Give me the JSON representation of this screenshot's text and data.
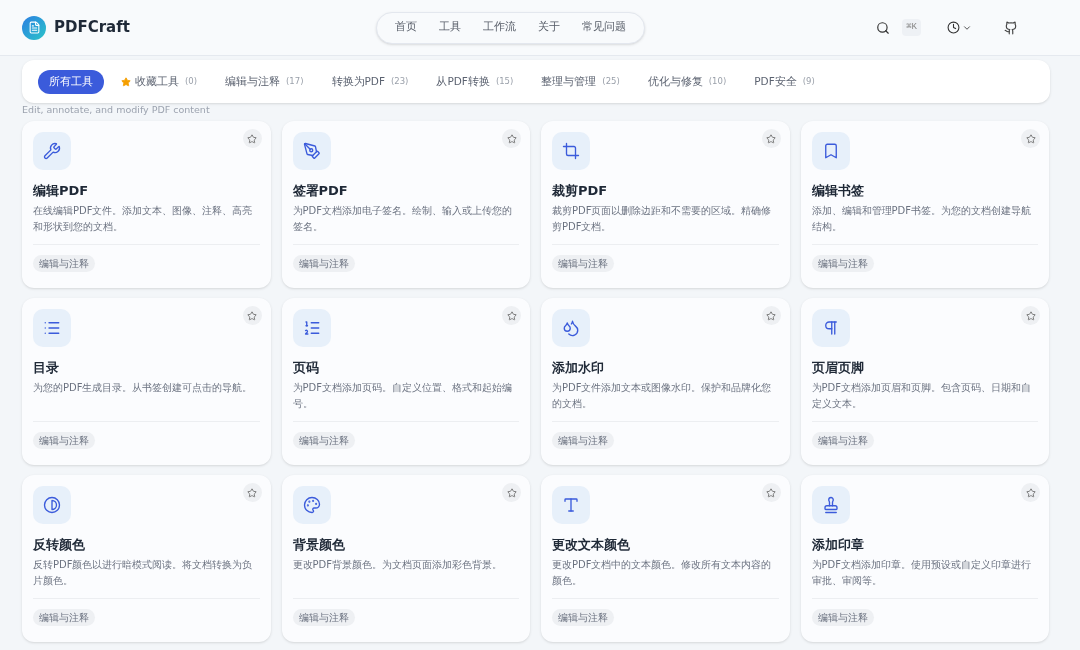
{
  "brand": {
    "name": "PDFCraft"
  },
  "nav": [
    {
      "label": "首页"
    },
    {
      "label": "工具"
    },
    {
      "label": "工作流"
    },
    {
      "label": "关于"
    },
    {
      "label": "常见问题"
    }
  ],
  "shortcut": "⌘K",
  "filters": [
    {
      "label": "所有工具",
      "kind": "plain",
      "selected": true
    },
    {
      "label": "收藏工具",
      "count": "(0)",
      "kind": "favorites",
      "selected": false
    },
    {
      "label": "编辑与注释",
      "count": "(17)",
      "kind": "plain",
      "selected": false
    },
    {
      "label": "转换为PDF",
      "count": "(23)",
      "kind": "plain",
      "selected": false
    },
    {
      "label": "从PDF转换",
      "count": "(15)",
      "kind": "plain",
      "selected": false
    },
    {
      "label": "整理与管理",
      "count": "(25)",
      "kind": "plain",
      "selected": false
    },
    {
      "label": "优化与修复",
      "count": "(10)",
      "kind": "plain",
      "selected": false
    },
    {
      "label": "PDF安全",
      "count": "(9)",
      "kind": "plain",
      "selected": false
    }
  ],
  "subtitle": "Edit, annotate, and modify PDF content",
  "tools": [
    {
      "title": "编辑PDF",
      "description": "在线编辑PDF文件。添加文本、图像、注释、高亮和形状到您的文档。",
      "tag": "编辑与注释"
    },
    {
      "title": "签署PDF",
      "description": "为PDF文档添加电子签名。绘制、输入或上传您的签名。",
      "tag": "编辑与注释"
    },
    {
      "title": "裁剪PDF",
      "description": "裁剪PDF页面以删除边距和不需要的区域。精确修剪PDF文档。",
      "tag": "编辑与注释"
    },
    {
      "title": "编辑书签",
      "description": "添加、编辑和管理PDF书签。为您的文档创建导航结构。",
      "tag": "编辑与注释"
    },
    {
      "title": "目录",
      "description": "为您的PDF生成目录。从书签创建可点击的导航。",
      "tag": "编辑与注释"
    },
    {
      "title": "页码",
      "description": "为PDF文档添加页码。自定义位置、格式和起始编号。",
      "tag": "编辑与注释"
    },
    {
      "title": "添加水印",
      "description": "为PDF文件添加文本或图像水印。保护和品牌化您的文档。",
      "tag": "编辑与注释"
    },
    {
      "title": "页眉页脚",
      "description": "为PDF文档添加页眉和页脚。包含页码、日期和自定义文本。",
      "tag": "编辑与注释"
    },
    {
      "title": "反转颜色",
      "description": "反转PDF颜色以进行暗模式阅读。将文档转换为负片颜色。",
      "tag": "编辑与注释"
    },
    {
      "title": "背景颜色",
      "description": "更改PDF背景颜色。为文档页面添加彩色背景。",
      "tag": "编辑与注释"
    },
    {
      "title": "更改文本颜色",
      "description": "更改PDF文档中的文本颜色。修改所有文本内容的颜色。",
      "tag": "编辑与注释"
    },
    {
      "title": "添加印章",
      "description": "为PDF文档添加印章。使用预设或自定义印章进行审批、审阅等。",
      "tag": "编辑与注释"
    }
  ]
}
